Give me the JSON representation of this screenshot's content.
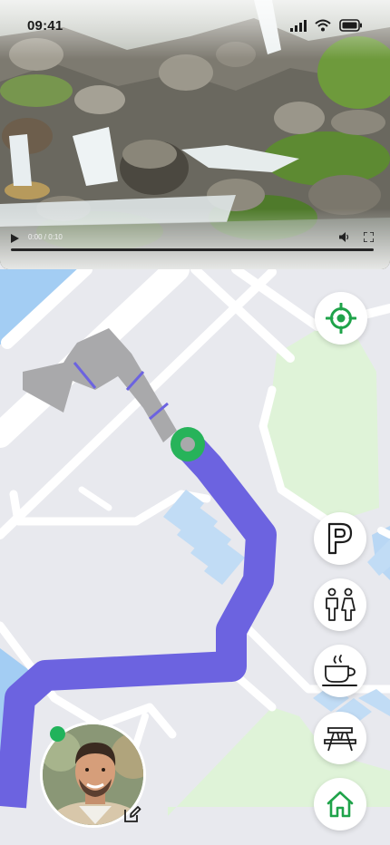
{
  "status_bar": {
    "time": "09:41",
    "icons": [
      "cellular-signal-icon",
      "wifi-icon",
      "battery-icon"
    ]
  },
  "video": {
    "time_display": "0:00 / 0:10",
    "progress": 0.0,
    "controls": [
      "play-icon",
      "volume-icon",
      "fullscreen-icon"
    ]
  },
  "map": {
    "buttons": [
      {
        "name": "locate-me",
        "icon": "crosshair-icon",
        "color": "#1fa34a"
      },
      {
        "name": "parking",
        "label": "P",
        "icon": "parking-icon"
      },
      {
        "name": "restrooms",
        "icon": "restroom-icon"
      },
      {
        "name": "cafe",
        "icon": "coffee-cup-icon"
      },
      {
        "name": "picnic",
        "icon": "picnic-table-icon"
      },
      {
        "name": "home",
        "icon": "home-icon",
        "color": "#1fa34a"
      }
    ],
    "colors": {
      "route": "#6c63e0",
      "destination_marker": "#27b35a",
      "park": "#def3d8",
      "water": "#9ecbf2",
      "roads": "#ffffff"
    }
  },
  "user": {
    "avatar_icon": "user-photo",
    "status": "online",
    "edit_icon": "edit-icon"
  }
}
